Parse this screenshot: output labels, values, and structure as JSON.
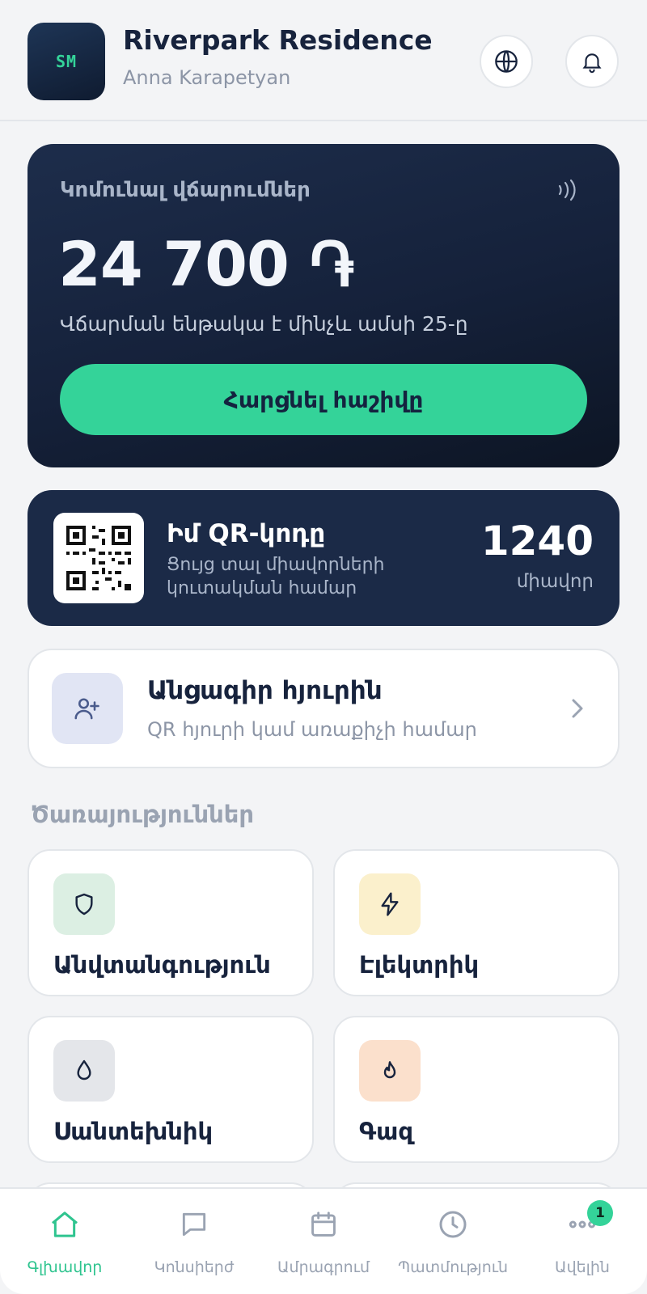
{
  "header": {
    "logo_text": "SM",
    "title": "Riverpark Residence",
    "subtitle": "Anna Karapetyan",
    "globe_icon": "globe-icon",
    "bell_icon": "bell-icon"
  },
  "payment": {
    "label": "Կոմունալ վճարումներ",
    "amount": "24 700 ֏",
    "note": "Վճարման ենթակա է մինչև ամսի 25-ը",
    "button_label": "Հարցնել հաշիվը",
    "nfc_icon": "contactless-icon"
  },
  "qr": {
    "title": "Իմ QR-կոդը",
    "description": "Ցույց տալ միավորների կուտակման համար",
    "points": "1240",
    "points_label": "միավոր"
  },
  "guest": {
    "title": "Անցագիր հյուրին",
    "description": "QR հյուրի կամ առաքիչի համար",
    "icon": "user-plus-icon"
  },
  "services": {
    "title": "Ծառայություններ",
    "items": [
      {
        "label": "Անվտանգություն",
        "icon": "shield-icon",
        "color": "#dcefe3"
      },
      {
        "label": "Էլեկտրիկ",
        "icon": "bolt-icon",
        "color": "#fbf0cc"
      },
      {
        "label": "Սանտեխնիկ",
        "icon": "droplet-icon",
        "color": "#e4e6ea"
      },
      {
        "label": "Գազ",
        "icon": "flame-icon",
        "color": "#fbe0cc"
      }
    ]
  },
  "nav": {
    "items": [
      {
        "label": "Գլխավոր",
        "icon": "home-icon",
        "active": true
      },
      {
        "label": "Կոնսիերժ",
        "icon": "chat-icon"
      },
      {
        "label": "Ամրագրում",
        "icon": "calendar-icon"
      },
      {
        "label": "Պատմություն",
        "icon": "clock-icon"
      },
      {
        "label": "Ավելին",
        "icon": "more-icon",
        "badge": "1"
      }
    ]
  },
  "colors": {
    "accent": "#34d399",
    "card_dark": "#1b2a47",
    "text_dark": "#17233d"
  }
}
